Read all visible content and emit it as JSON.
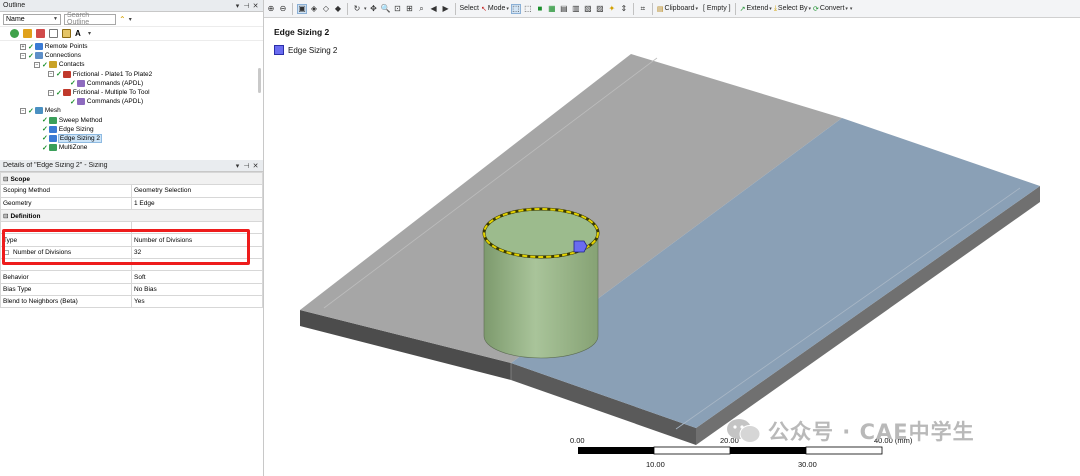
{
  "outline": {
    "title": "Outline",
    "panel_controls": [
      "▾",
      "📌",
      "✕"
    ],
    "name_combo": "Name",
    "search_placeholder": "Search Outline",
    "tree": [
      {
        "label": "Remote Points",
        "level": 1,
        "exp": "+"
      },
      {
        "label": "Connections",
        "level": 1,
        "exp": "−"
      },
      {
        "label": "Contacts",
        "level": 2,
        "exp": "−"
      },
      {
        "label": "Frictional - Plate1 To Plate2",
        "level": 3,
        "exp": "−"
      },
      {
        "label": "Commands (APDL)",
        "level": 4,
        "exp": ""
      },
      {
        "label": "Frictional - Multiple To Tool",
        "level": 3,
        "exp": "−"
      },
      {
        "label": "Commands (APDL)",
        "level": 4,
        "exp": ""
      },
      {
        "label": "Mesh",
        "level": 1,
        "exp": "−"
      },
      {
        "label": "Sweep Method",
        "level": 2,
        "exp": ""
      },
      {
        "label": "Edge Sizing",
        "level": 2,
        "exp": ""
      },
      {
        "label": "Edge Sizing 2",
        "level": 2,
        "exp": "",
        "selected": true
      },
      {
        "label": "MultiZone",
        "level": 2,
        "exp": ""
      }
    ]
  },
  "details": {
    "title": "Details of \"Edge Sizing 2\" - Sizing",
    "panel_controls": [
      "▾",
      "📌",
      "✕"
    ],
    "rows": [
      {
        "type": "cat",
        "label": "Scope"
      },
      {
        "key": "Scoping Method",
        "value": "Geometry Selection"
      },
      {
        "key": "Geometry",
        "value": "1 Edge"
      },
      {
        "type": "cat",
        "label": "Definition"
      },
      {
        "key": "",
        "value": ""
      },
      {
        "key": "Type",
        "value": "Number of Divisions"
      },
      {
        "key": "Number of Divisions",
        "value": "32",
        "indent": true
      },
      {
        "key": "",
        "value": ""
      },
      {
        "key": "Behavior",
        "value": "Soft"
      },
      {
        "key": "Bias Type",
        "value": "No Bias"
      },
      {
        "key": "Blend to Neighbors (Beta)",
        "value": "Yes"
      }
    ]
  },
  "toolbar": {
    "select": "Select",
    "mode": "Mode",
    "clipboard": "Clipboard",
    "empty": "[ Empty ]",
    "extend": "Extend",
    "select_by": "Select By",
    "convert": "Convert"
  },
  "viewport": {
    "title": "Edge Sizing 2",
    "legend_label": "Edge Sizing 2",
    "colors": {
      "plate_top": "#a6a6a6",
      "plate_blue": "#8aa0b6",
      "plate_side": "#4c4c4c",
      "cylinder": "#93b07f",
      "cylinder_top": "#9cbb8d",
      "highlight_edge": "#e3d200",
      "legend_swatch": "#6a6cf0"
    },
    "scale": {
      "labels_top": [
        "0.00",
        "20.00",
        "40.00 (mm)"
      ],
      "labels_bottom": [
        "10.00",
        "30.00"
      ]
    }
  },
  "watermark": "公众号 · CAE中学生"
}
